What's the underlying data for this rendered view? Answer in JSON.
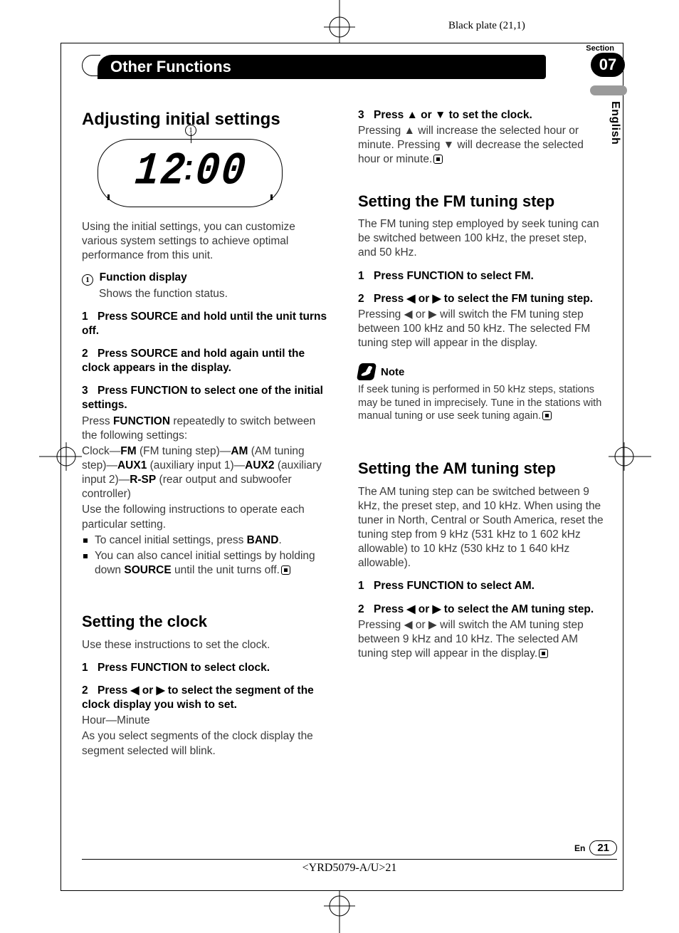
{
  "meta": {
    "black_plate": "Black plate (21,1)",
    "section_word": "Section",
    "section_num": "07",
    "language": "English",
    "chapter_title": "Other Functions",
    "footer_lang": "En",
    "footer_page": "21",
    "footer_code": "<YRD5079-A/U>21"
  },
  "lcd": {
    "callout": "1",
    "time_h1": "1",
    "time_h2": "2",
    "time_m1": "0",
    "time_m2": "0"
  },
  "left": {
    "h_adjust": "Adjusting initial settings",
    "intro": "Using the initial settings, you can customize various system settings to achieve optimal performance from this unit.",
    "func_num": "1",
    "func_label": "Function display",
    "func_desc": "Shows the function status.",
    "s1": "Press SOURCE and hold until the unit turns off.",
    "s2": "Press SOURCE and hold again until the clock appears in the display.",
    "s3": "Press FUNCTION to select one of the initial settings.",
    "s3_p1a": "Press ",
    "s3_p1b": "FUNCTION",
    "s3_p1c": " repeatedly to switch between the following settings:",
    "s3_list_a": "Clock—",
    "s3_list_b": "FM",
    "s3_list_c": " (FM tuning step)—",
    "s3_list_d": "AM",
    "s3_list_e": " (AM tuning step)—",
    "s3_list_f": "AUX1",
    "s3_list_g": " (auxiliary input 1)—",
    "s3_list_h": "AUX2",
    "s3_list_i": " (auxiliary input 2)—",
    "s3_list_j": "R-SP",
    "s3_list_k": " (rear output and subwoofer controller)",
    "s3_p2": "Use the following instructions to operate each particular setting.",
    "b1a": "To cancel initial settings, press ",
    "b1b": "BAND",
    "b1c": ".",
    "b2a": "You can also cancel initial settings by holding down ",
    "b2b": "SOURCE",
    "b2c": " until the unit turns off.",
    "h_clock": "Setting the clock",
    "clock_intro": "Use these instructions to set the clock.",
    "c1": "Press FUNCTION to select clock.",
    "c2": "Press ◀ or ▶ to select the segment of the clock display you wish to set.",
    "c2_p1": "Hour—Minute",
    "c2_p2": "As you select segments of the clock display the segment selected will blink."
  },
  "right": {
    "c3": "Press ▲ or ▼ to set the clock.",
    "c3_p": "Pressing ▲ will increase the selected hour or minute. Pressing ▼ will decrease the selected hour or minute.",
    "h_fm": "Setting the FM tuning step",
    "fm_intro": "The FM tuning step employed by seek tuning can be switched between 100 kHz, the preset step, and 50 kHz.",
    "f1": "Press FUNCTION to select FM.",
    "f2": "Press ◀ or ▶ to select the FM tuning step.",
    "f2_p": "Pressing ◀ or ▶ will switch the FM tuning step between 100 kHz and 50 kHz. The selected FM tuning step will appear in the display.",
    "note_label": "Note",
    "note_p": "If seek tuning is performed in 50 kHz steps, stations may be tuned in imprecisely. Tune in the stations with manual tuning or use seek tuning again.",
    "h_am": "Setting the AM tuning step",
    "am_intro": "The AM tuning step can be switched between 9 kHz, the preset step, and 10 kHz. When using the tuner in North, Central or South America, reset the tuning step from 9 kHz (531 kHz to 1 602 kHz allowable) to 10 kHz (530 kHz to 1 640 kHz allowable).",
    "a1": "Press FUNCTION to select AM.",
    "a2": "Press ◀ or ▶ to select the AM tuning step.",
    "a2_p": "Pressing ◀ or ▶ will switch the AM tuning step between 9 kHz and 10 kHz. The selected AM tuning step will appear in the display."
  }
}
